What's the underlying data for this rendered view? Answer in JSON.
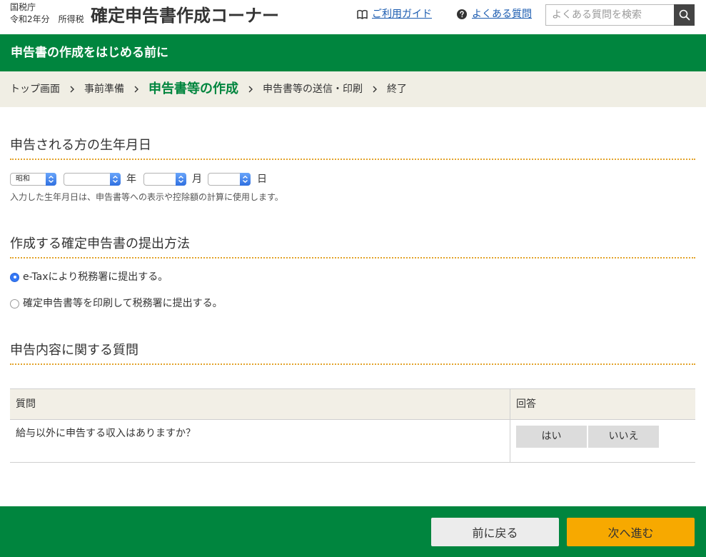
{
  "header": {
    "agency": "国税庁",
    "year_tax": "令和2年分　所得税",
    "title": "確定申告書作成コーナー",
    "guide_link": {
      "label": "ご利用ガイド",
      "icon": "book-icon"
    },
    "faq_link": {
      "label": "よくある質問",
      "icon": "question-circle-icon"
    },
    "search": {
      "placeholder": "よくある質問を検索",
      "value": "",
      "button_icon": "search-icon"
    }
  },
  "page_banner": {
    "title": "申告書の作成をはじめる前に"
  },
  "breadcrumb": {
    "separator_icon": "chevron-right-icon",
    "items": [
      {
        "label": "トップ画面",
        "current": false
      },
      {
        "label": "事前準備",
        "current": false
      },
      {
        "label": "申告書等の作成",
        "current": true
      },
      {
        "label": "申告書等の送信・印刷",
        "current": false
      },
      {
        "label": "終了",
        "current": false
      }
    ]
  },
  "birthdate": {
    "heading": "申告される方の生年月日",
    "era": {
      "value": "昭和"
    },
    "year": {
      "value": "",
      "unit": "年"
    },
    "month": {
      "value": "",
      "unit": "月"
    },
    "day": {
      "value": "",
      "unit": "日"
    },
    "note": "入力した生年月日は、申告書等への表示や控除額の計算に使用します。"
  },
  "filing_method": {
    "heading": "作成する確定申告書の提出方法",
    "options": [
      {
        "label": "e-Taxにより税務署に提出する。",
        "selected": true
      },
      {
        "label": "確定申告書等を印刷して税務署に提出する。",
        "selected": false
      }
    ]
  },
  "questions": {
    "heading": "申告内容に関する質問",
    "columns": {
      "question": "質問",
      "answer": "回答"
    },
    "rows": [
      {
        "question": "給与以外に申告する収入はありますか？",
        "yes_label": "はい",
        "no_label": "いいえ"
      }
    ]
  },
  "footer": {
    "back_label": "前に戻る",
    "next_label": "次へ進む"
  },
  "colors": {
    "brand_green": "#00853e",
    "next_button": "#f7a900",
    "breadcrumb_bg": "#f0eee4",
    "table_header_bg": "#f2efe6",
    "link_blue": "#1a5bb0",
    "section_rule": "#e3a32a",
    "radio_selected": "#3478f6"
  }
}
